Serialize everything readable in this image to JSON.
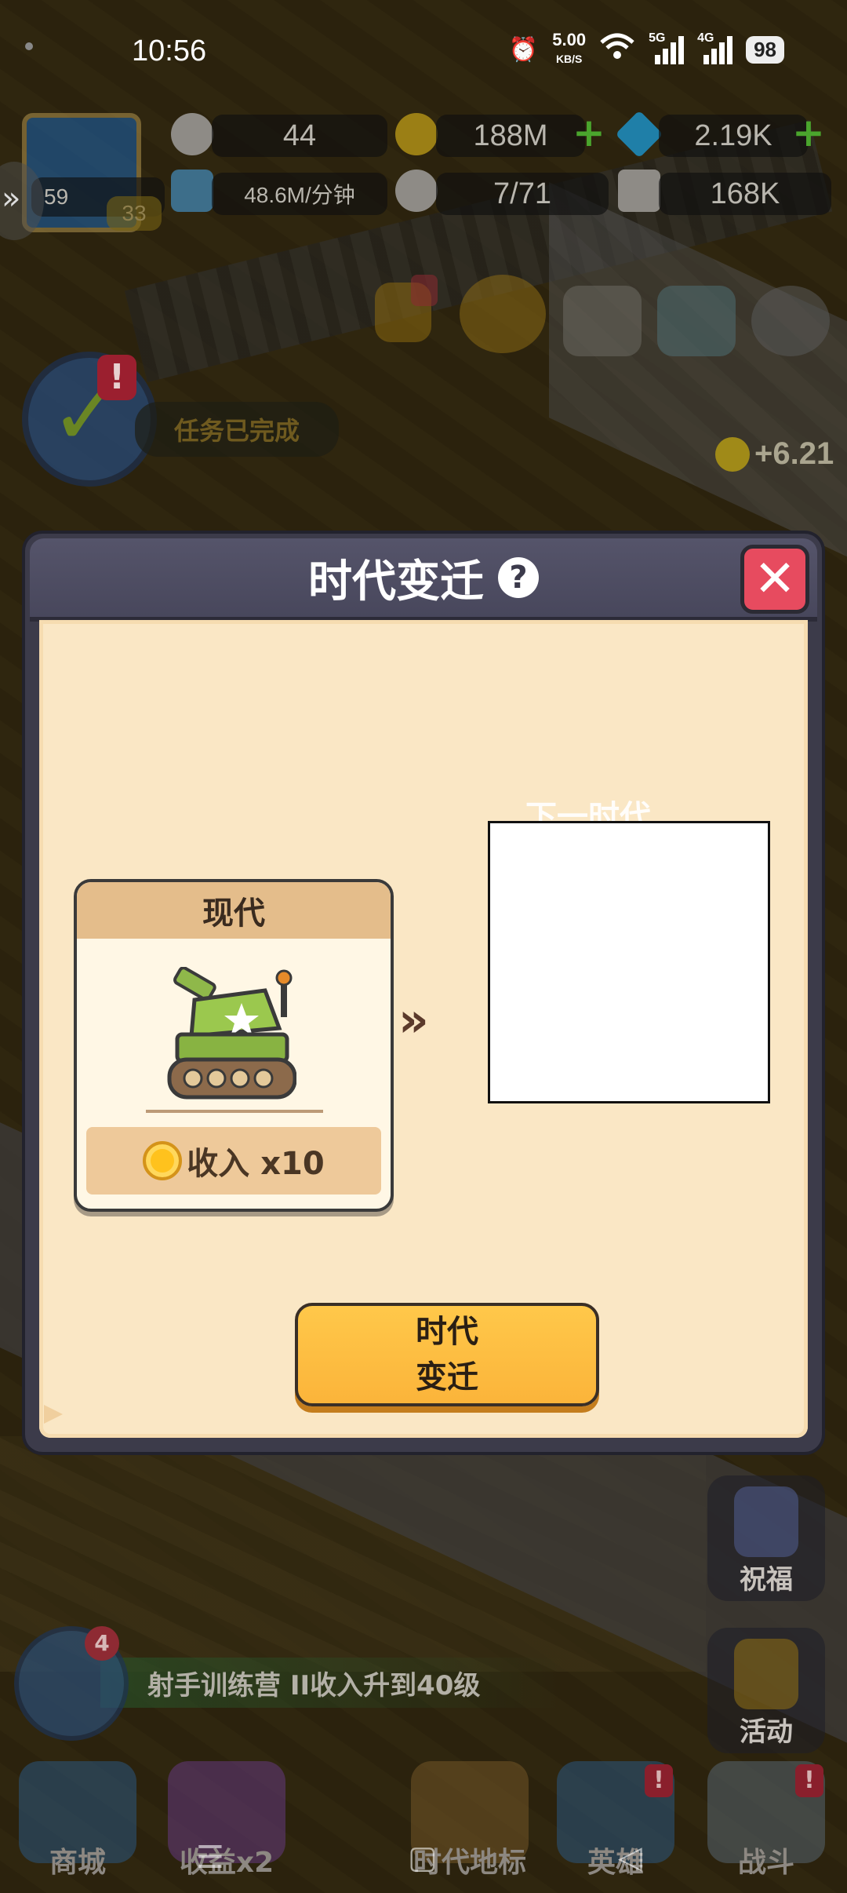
{
  "status_bar": {
    "time": "10:56",
    "net_speed_value": "5.00",
    "net_speed_unit": "KB/S",
    "sim1": "5G",
    "sim2": "4G",
    "battery": "98"
  },
  "hud": {
    "level": "59",
    "sub_level": "33",
    "chef_count": "44",
    "coins": "188M",
    "gems": "2.19K",
    "income_rate": "48.6M/分钟",
    "staff": "7/71",
    "power": "168K"
  },
  "task": {
    "alert": "!",
    "label": "任务已完成"
  },
  "floating_coin": "+6.21",
  "dialog": {
    "title": "时代变迁",
    "help_symbol": "?",
    "close_symbol": "✕",
    "current_era": {
      "name": "现代",
      "income_label": "收入 x10"
    },
    "arrow": "»",
    "next_era_label": "下一时代",
    "advance_button": "时代\n变迁"
  },
  "side_buttons": {
    "blessing": "祝福",
    "activity": "活动"
  },
  "quest": {
    "badge": "4",
    "text": "射手训练营 II收入升到40级"
  },
  "bottom_nav": [
    {
      "label": "商城",
      "alert": ""
    },
    {
      "label": "收益x2",
      "alert": ""
    },
    {
      "label": "时代地标",
      "alert": ""
    },
    {
      "label": "英雄",
      "alert": "!"
    },
    {
      "label": "战斗",
      "alert": "!"
    }
  ],
  "colors": {
    "dialog_header": "#48475c",
    "dialog_body": "#fae7c5",
    "close_red": "#e74b5f",
    "button_yellow": "#fbb43a",
    "card_header": "#e4bd8b"
  }
}
